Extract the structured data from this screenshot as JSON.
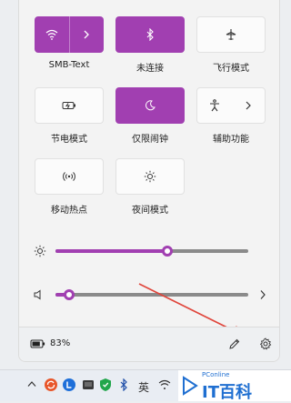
{
  "quick_settings": {
    "tiles": [
      {
        "id": "wifi",
        "label": "SMB-Text",
        "state": "on",
        "icon": "wifi-icon",
        "has_chevron": true
      },
      {
        "id": "bluetooth",
        "label": "未连接",
        "state": "on",
        "icon": "bluetooth-icon",
        "has_chevron": false
      },
      {
        "id": "airplane",
        "label": "飞行模式",
        "state": "off",
        "icon": "airplane-icon",
        "has_chevron": false
      },
      {
        "id": "battery_saver",
        "label": "节电模式",
        "state": "off",
        "icon": "battery-saver-icon",
        "has_chevron": false
      },
      {
        "id": "focus",
        "label": "仅限闹钟",
        "state": "on",
        "icon": "moon-icon",
        "has_chevron": false
      },
      {
        "id": "accessibility",
        "label": "辅助功能",
        "state": "off",
        "icon": "accessibility-icon",
        "has_chevron": true
      },
      {
        "id": "hotspot",
        "label": "移动热点",
        "state": "off",
        "icon": "hotspot-icon",
        "has_chevron": false
      },
      {
        "id": "night_light",
        "label": "夜间模式",
        "state": "off",
        "icon": "brightness-icon",
        "has_chevron": false
      }
    ],
    "brightness": {
      "level": 0.58
    },
    "volume": {
      "level": 0.07,
      "has_chevron": true
    },
    "battery": {
      "text": "83%",
      "level": 0.83
    },
    "accent_color": "#a13fb1"
  },
  "taskbar": {
    "input_method": "英",
    "watermark_brand": "PConline",
    "watermark_text": "IT百科"
  }
}
